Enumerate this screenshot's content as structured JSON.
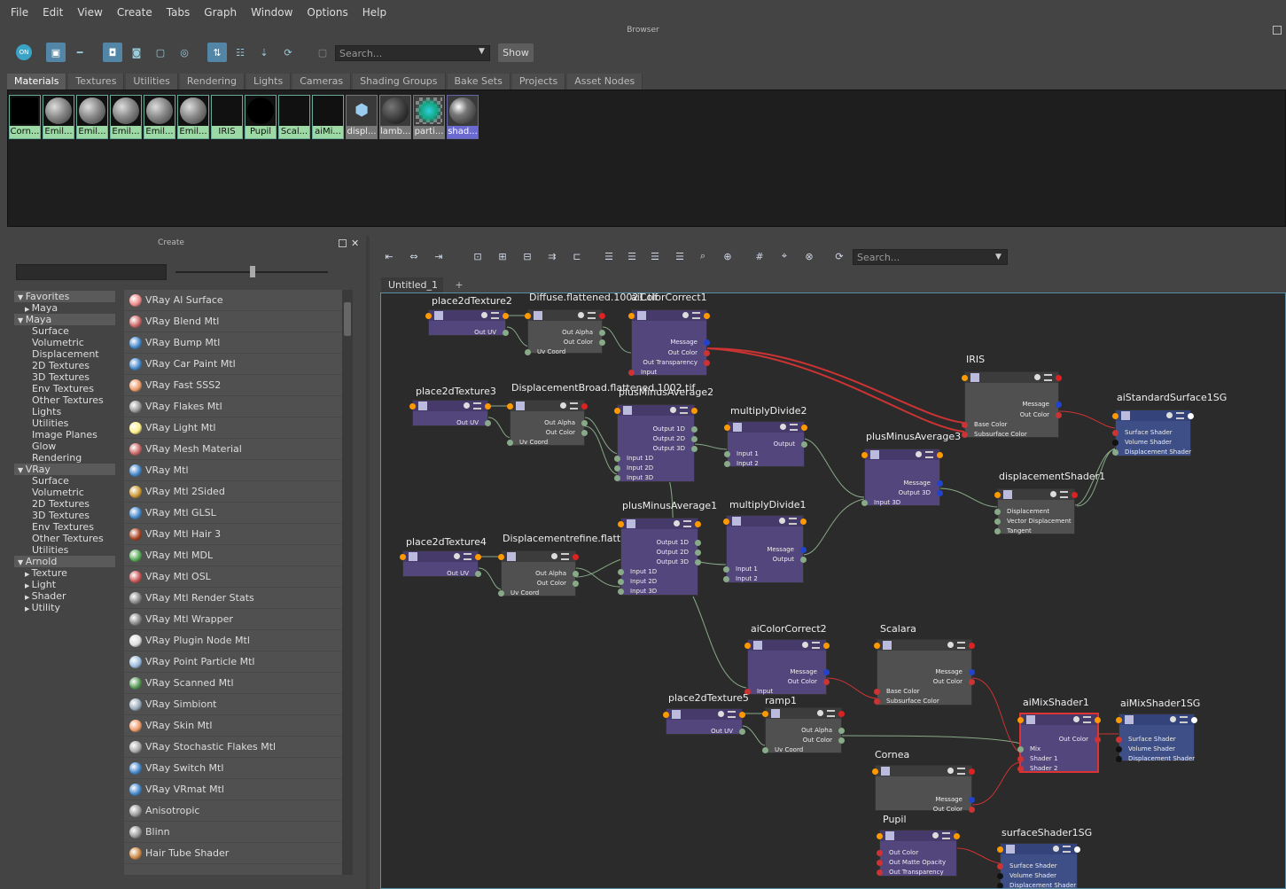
{
  "menu": [
    "File",
    "Edit",
    "View",
    "Create",
    "Tabs",
    "Graph",
    "Window",
    "Options",
    "Help"
  ],
  "browser": {
    "title": "Browser",
    "search_placeholder": "Search...",
    "show_label": "Show",
    "on_label": "ON",
    "tabs": [
      "Materials",
      "Textures",
      "Utilities",
      "Rendering",
      "Lights",
      "Cameras",
      "Shading Groups",
      "Bake Sets",
      "Projects",
      "Asset Nodes"
    ],
    "swatches": [
      "Corn...",
      "Emil...",
      "Emil...",
      "Emil...",
      "Emil...",
      "Emil...",
      "IRIS",
      "Pupil",
      "Scal...",
      "aiMi...",
      "displ...",
      "lamb...",
      "parti...",
      "shad..."
    ]
  },
  "create": {
    "title": "Create",
    "tree": [
      {
        "label": "Favorites",
        "level": 0,
        "cat": true
      },
      {
        "label": "Maya",
        "level": 1,
        "arrow": true
      },
      {
        "label": "Maya",
        "level": 0,
        "cat": true
      },
      {
        "label": "Surface",
        "level": 1
      },
      {
        "label": "Volumetric",
        "level": 1
      },
      {
        "label": "Displacement",
        "level": 1
      },
      {
        "label": "2D Textures",
        "level": 1
      },
      {
        "label": "3D Textures",
        "level": 1
      },
      {
        "label": "Env Textures",
        "level": 1
      },
      {
        "label": "Other Textures",
        "level": 1
      },
      {
        "label": "Lights",
        "level": 1
      },
      {
        "label": "Utilities",
        "level": 1
      },
      {
        "label": "Image Planes",
        "level": 1
      },
      {
        "label": "Glow",
        "level": 1
      },
      {
        "label": "Rendering",
        "level": 1
      },
      {
        "label": "VRay",
        "level": 0,
        "cat": true
      },
      {
        "label": "Surface",
        "level": 1
      },
      {
        "label": "Volumetric",
        "level": 1
      },
      {
        "label": "2D Textures",
        "level": 1
      },
      {
        "label": "3D Textures",
        "level": 1
      },
      {
        "label": "Env Textures",
        "level": 1
      },
      {
        "label": "Other Textures",
        "level": 1
      },
      {
        "label": "Utilities",
        "level": 1
      },
      {
        "label": "Arnold",
        "level": 0,
        "cat": true
      },
      {
        "label": "Texture",
        "level": 1,
        "arrow": true
      },
      {
        "label": "Light",
        "level": 1,
        "arrow": true
      },
      {
        "label": "Shader",
        "level": 1,
        "arrow": true
      },
      {
        "label": "Utility",
        "level": 1,
        "arrow": true
      }
    ],
    "materials": [
      "VRay Al Surface",
      "VRay Blend Mtl",
      "VRay Bump Mtl",
      "VRay Car Paint Mtl",
      "VRay Fast SSS2",
      "VRay Flakes Mtl",
      "VRay Light Mtl",
      "VRay Mesh Material",
      "VRay Mtl",
      "VRay Mtl 2Sided",
      "VRay Mtl GLSL",
      "VRay Mtl Hair 3",
      "VRay Mtl MDL",
      "VRay Mtl OSL",
      "VRay Mtl Render Stats",
      "VRay Mtl Wrapper",
      "VRay Plugin Node Mtl",
      "VRay Point Particle Mtl",
      "VRay Scanned Mtl",
      "VRay Simbiont",
      "VRay Skin Mtl",
      "VRay Stochastic Flakes Mtl",
      "VRay Switch Mtl",
      "VRay VRmat Mtl",
      "Anisotropic",
      "Blinn",
      "Hair Tube Shader"
    ],
    "material_icons": [
      "#e88",
      "#c66",
      "#48c",
      "#48c",
      "#e96",
      "#999",
      "#fe8",
      "#c66",
      "#48c",
      "#c93",
      "#48c",
      "#a42",
      "#5a5",
      "#c55",
      "#888",
      "#888",
      "#ddd",
      "#9bd",
      "#595",
      "#9ab",
      "#e96",
      "#aaa",
      "#48c",
      "#48c",
      "#999",
      "#999",
      "#c84"
    ]
  },
  "node_editor": {
    "tab": "Untitled_1",
    "plus": "+",
    "search_placeholder": "Search...",
    "nodes": {
      "place2dTexture2": "place2dTexture2",
      "diffuse": "Diffuse.flattened.10021.tif",
      "aiColorCorrect1": "aiColorCorrect1",
      "iris": "IRIS",
      "aiStandardSurface1SG": "aiStandardSurface1SG",
      "place2dTexture3": "place2dTexture3",
      "dispBroad": "DisplacementBroad.flattened.1002.tif",
      "plusMinusAverage2": "plusMinusAverage2",
      "multiplyDivide2": "multiplyDivide2",
      "plusMinusAverage3": "plusMinusAverage3",
      "displacementShader1": "displacementShader1",
      "place2dTexture4": "place2dTexture4",
      "dispRefine": "Displacementrefine.flatteneo",
      "plusMinusAverage1": "plusMinusAverage1",
      "multiplyDivide1": "multiplyDivide1",
      "aiColorCorrect2": "aiColorCorrect2",
      "scalara": "Scalara",
      "place2dTexture5": "place2dTexture5",
      "ramp1": "ramp1",
      "aiMixShader1": "aiMixShader1",
      "aiMixShader1SG": "aiMixShader1SG",
      "cornea": "Cornea",
      "pupil": "Pupil",
      "surfaceShader1SG": "surfaceShader1SG"
    },
    "ports": {
      "out_uv": "Out UV",
      "out_alpha": "Out Alpha",
      "out_color": "Out Color",
      "uv_coord": "Uv Coord",
      "message": "Message",
      "out_transparency": "Out Transparency",
      "input": "Input",
      "base_color": "Base Color",
      "subsurface_color": "Subsurface Color",
      "surface_shader": "Surface Shader",
      "volume_shader": "Volume Shader",
      "displacement_shader": "Displacement Shader",
      "output1d": "Output 1D",
      "output2d": "Output 2D",
      "output3d": "Output 3D",
      "input1d": "Input 1D",
      "input2d": "Input 2D",
      "input3d": "Input 3D",
      "output": "Output",
      "input1": "Input 1",
      "input2": "Input 2",
      "displacement": "Displacement",
      "vector_displacement": "Vector Displacement",
      "tangent": "Tangent",
      "mix": "Mix",
      "shader1": "Shader 1",
      "shader2": "Shader 2",
      "out_matte_opacity": "Out Matte Opacity"
    }
  }
}
